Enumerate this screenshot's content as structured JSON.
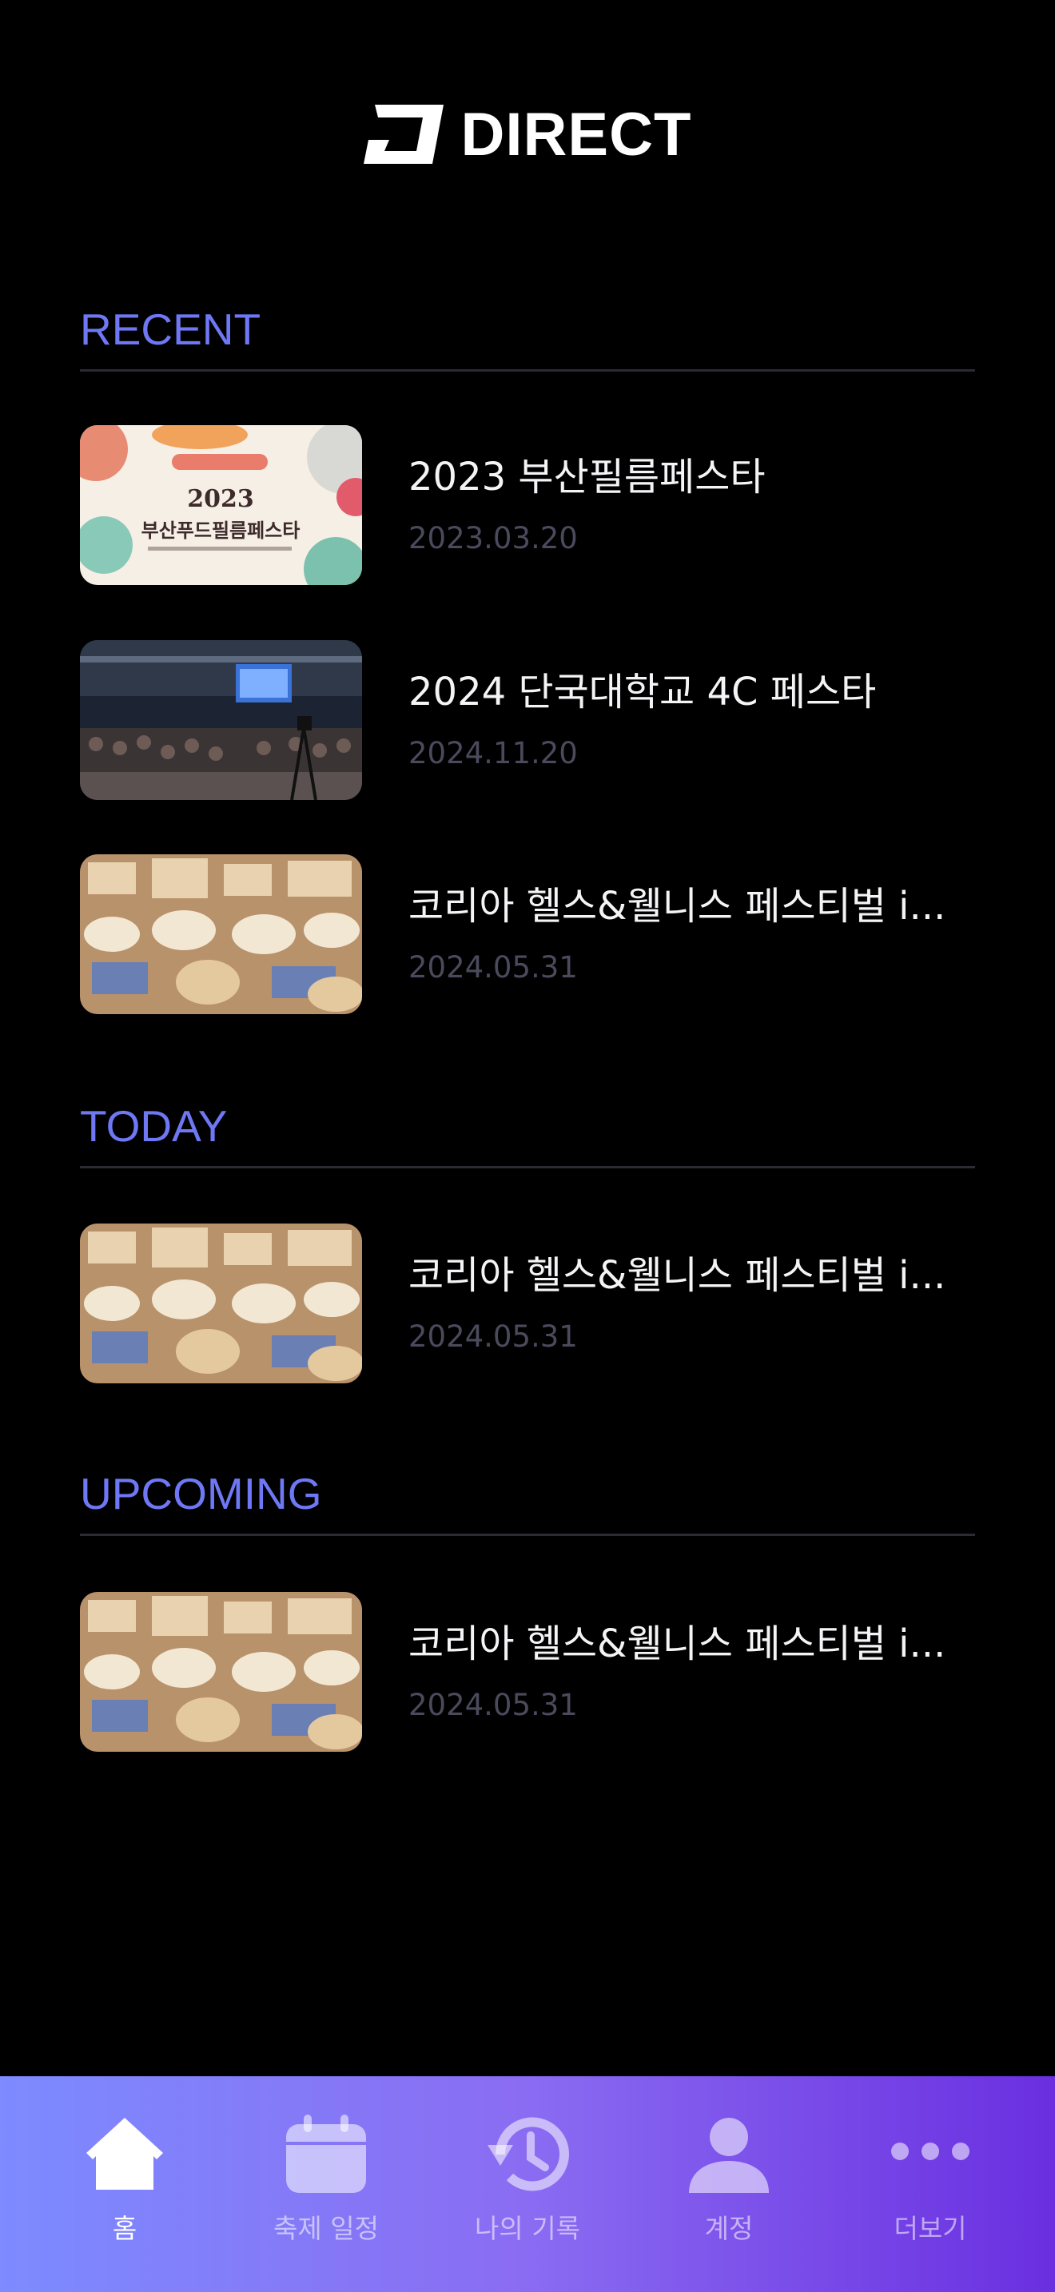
{
  "header": {
    "brand": "DIRECT"
  },
  "sections": {
    "recent": {
      "title": "RECENT",
      "items": [
        {
          "title": "2023 부산필름페스타",
          "date": "2023.03.20"
        },
        {
          "title": "2024 단국대학교 4C 페스타",
          "date": "2024.11.20"
        },
        {
          "title": "코리아 헬스&웰니스 페스티벌 i...",
          "date": "2024.05.31"
        }
      ]
    },
    "today": {
      "title": "TODAY",
      "items": [
        {
          "title": "코리아 헬스&웰니스 페스티벌 i...",
          "date": "2024.05.31"
        }
      ]
    },
    "upcoming": {
      "title": "UPCOMING",
      "items": [
        {
          "title": "코리아 헬스&웰니스 페스티벌 i...",
          "date": "2024.05.31"
        }
      ]
    }
  },
  "thumb_text": {
    "poster_year": "2023",
    "poster_title": "부산푸드필름페스타"
  },
  "tabbar": {
    "tabs": [
      {
        "label": "홈",
        "icon": "home-icon",
        "active": true
      },
      {
        "label": "축제 일정",
        "icon": "calendar-icon",
        "active": false
      },
      {
        "label": "나의 기록",
        "icon": "history-icon",
        "active": false
      },
      {
        "label": "계정",
        "icon": "person-icon",
        "active": false
      },
      {
        "label": "더보기",
        "icon": "more-icon",
        "active": false
      }
    ]
  },
  "colors": {
    "accent": "#6e78f5",
    "background": "#000000",
    "date": "#4a4a5c"
  }
}
